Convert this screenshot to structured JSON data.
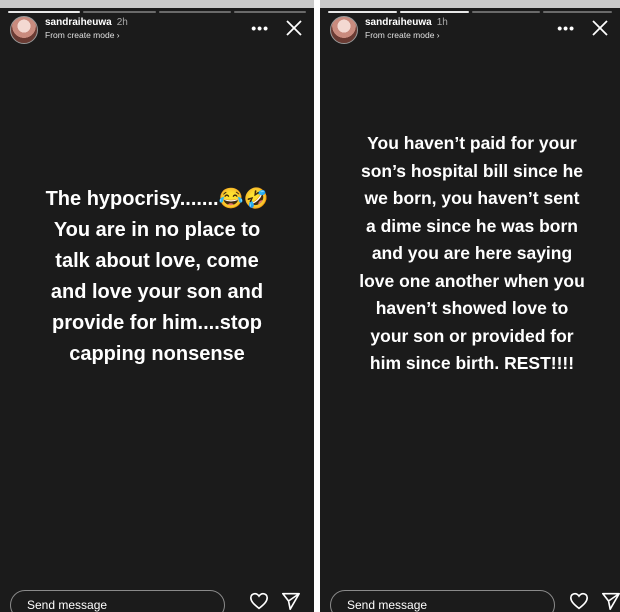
{
  "stories": [
    {
      "username": "sandraiheuwa",
      "time": "2h",
      "subtitle": "From create mode ›",
      "more_icon": "more-horizontal-icon",
      "close_icon": "close-icon",
      "text": "The hypocrisy.......😂🤣\nYou are in no place to\ntalk about love, come\nand love your son and\nprovide for him....stop\ncapping nonsense",
      "message_placeholder": "Send message",
      "progress_segments": 4,
      "progress_done": 1
    },
    {
      "username": "sandraiheuwa",
      "time": "1h",
      "subtitle": "From create mode ›",
      "more_icon": "more-horizontal-icon",
      "close_icon": "close-icon",
      "text": "You haven’t paid for your\nson’s hospital bill since he\nwe born, you haven’t sent\na dime since he was born\nand you are here saying\nlove one another when you\nhaven’t showed love to\nyour son or provided for\nhim since birth. REST!!!!",
      "message_placeholder": "Send message",
      "progress_segments": 4,
      "progress_done": 2
    }
  ],
  "colors": {
    "story_background": "#1b1b1b",
    "text": "#ffffff",
    "separator": "#ffffff"
  }
}
